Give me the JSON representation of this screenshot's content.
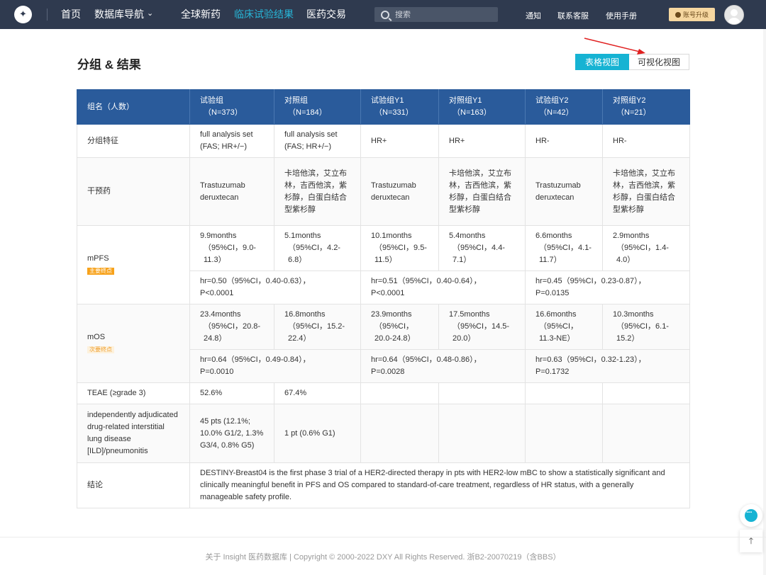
{
  "nav": {
    "logo_glyph": "✦",
    "items": [
      "首页",
      "数据库导航",
      "全球新药",
      "临床试验结果",
      "医药交易"
    ],
    "dropdown_caret": "⌄",
    "search_placeholder": "搜索",
    "right_links": [
      "通知",
      "联系客服",
      "使用手册"
    ],
    "upgrade_label": "账号升级"
  },
  "section": {
    "title": "分组 & 结果",
    "view_buttons": [
      "表格视图",
      "可视化视图"
    ],
    "active_view": "表格视图"
  },
  "table": {
    "headers": [
      {
        "name": "组名（人数）",
        "n": ""
      },
      {
        "name": "试验组",
        "n": "（N=373）"
      },
      {
        "name": "对照组",
        "n": "（N=184）"
      },
      {
        "name": "试验组Y1",
        "n": "（N=331）"
      },
      {
        "name": "对照组Y1",
        "n": "（N=163）"
      },
      {
        "name": "试验组Y2",
        "n": "（N=42）"
      },
      {
        "name": "对照组Y2",
        "n": "（N=21）"
      }
    ],
    "group_features": {
      "label": "分组特征",
      "values": [
        "full analysis set (FAS; HR+/−)",
        "full analysis set (FAS; HR+/−)",
        "HR+",
        "HR+",
        "HR-",
        "HR-"
      ]
    },
    "intervention": {
      "label": "干预药",
      "values": [
        "Trastuzumab deruxtecan",
        "卡培他滨，艾立布林，吉西他滨，紫杉醇，白蛋白结合型紫杉醇",
        "Trastuzumab deruxtecan",
        "卡培他滨，艾立布林，吉西他滨，紫杉醇，白蛋白结合型紫杉醇",
        "Trastuzumab deruxtecan",
        "卡培他滨，艾立布林，吉西他滨，紫杉醇，白蛋白结合型紫杉醇"
      ]
    },
    "mpfs": {
      "label": "mPFS",
      "tag": "主要终点",
      "values": [
        {
          "main": "9.9months",
          "ci": "（95%CI，9.0-11.3）"
        },
        {
          "main": "5.1months",
          "ci": "（95%CI，4.2-6.8）"
        },
        {
          "main": "10.1months",
          "ci": "（95%CI，9.5-11.5）"
        },
        {
          "main": "5.4months",
          "ci": "（95%CI，4.4-7.1）"
        },
        {
          "main": "6.6months",
          "ci": "（95%CI，4.1-11.7）"
        },
        {
          "main": "2.9months",
          "ci": "（95%CI，1.4-4.0）"
        }
      ],
      "hr": [
        {
          "hr": "hr=0.50（95%CI，0.40-0.63），",
          "p": "P<0.0001"
        },
        {
          "hr": "hr=0.51（95%CI，0.40-0.64），",
          "p": "P<0.0001"
        },
        {
          "hr": "hr=0.45（95%CI，0.23-0.87），",
          "p": "P=0.0135"
        }
      ]
    },
    "mos": {
      "label": "mOS",
      "tag": "次要终点",
      "values": [
        {
          "main": "23.4months",
          "ci": "（95%CI，20.8-24.8）"
        },
        {
          "main": "16.8months",
          "ci": "（95%CI，15.2-22.4）"
        },
        {
          "main": "23.9months",
          "ci": "（95%CI，20.0-24.8）"
        },
        {
          "main": "17.5months",
          "ci": "（95%CI，14.5-20.0）"
        },
        {
          "main": "16.6months",
          "ci": "（95%CI，11.3-NE）"
        },
        {
          "main": "10.3months",
          "ci": "（95%CI，6.1-15.2）"
        }
      ],
      "hr": [
        {
          "hr": "hr=0.64（95%CI，0.49-0.84），",
          "p": "P=0.0010"
        },
        {
          "hr": "hr=0.64（95%CI，0.48-0.86），",
          "p": "P=0.0028"
        },
        {
          "hr": "hr=0.63（95%CI，0.32-1.23），",
          "p": "P=0.1732"
        }
      ]
    },
    "teae": {
      "label": "TEAE (≥grade 3)",
      "values": [
        "52.6%",
        "67.4%",
        "",
        "",
        "",
        ""
      ]
    },
    "ild": {
      "label": "independently adjudicated drug-related interstitial lung disease [ILD]/pneumonitis",
      "values": [
        "45 pts (12.1%; 10.0% G1/2, 1.3% G3/4, 0.8% G5)",
        "1 pt (0.6% G1)",
        "",
        "",
        "",
        ""
      ]
    },
    "conclusion": {
      "label": "结论",
      "text": "DESTINY-Breast04 is the first phase 3 trial of a HER2-directed therapy in pts with HER2-low mBC to show a statistically significant and clinically meaningful benefit in PFS and OS compared to standard-of-care treatment, regardless of HR status, with a generally manageable safety profile."
    }
  },
  "colors": {
    "nav_bg": "#2f3a4f",
    "accent": "#16b3d3",
    "table_header": "#2a5b9b",
    "primary_tag": "#f7a21b",
    "annotation_arrow": "#e02020"
  },
  "floating": {
    "top_glyph": "⤒"
  },
  "footer": "关于 Insight 医药数据库 | Copyright © 2000-2022 DXY All Rights Reserved. 浙B2-20070219（含BBS）"
}
